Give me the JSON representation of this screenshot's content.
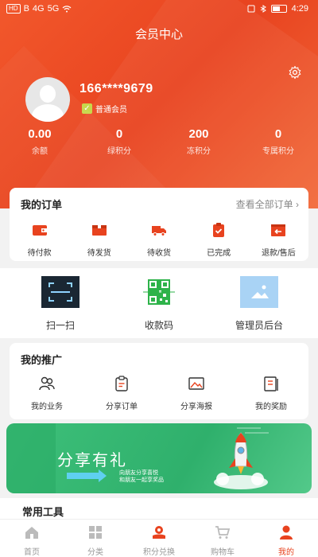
{
  "status_bar": {
    "left": [
      "HD",
      "B",
      "4G",
      "5G"
    ],
    "time": "4:29"
  },
  "header": {
    "title": "会员中心"
  },
  "profile": {
    "phone": "166****9679",
    "level": "普通会员"
  },
  "stats": [
    {
      "value": "0.00",
      "label": "余额"
    },
    {
      "value": "0",
      "label": "绿积分"
    },
    {
      "value": "200",
      "label": "冻积分"
    },
    {
      "value": "0",
      "label": "专属积分"
    }
  ],
  "orders": {
    "title": "我的订单",
    "view_all": "查看全部订单 ›",
    "items": [
      {
        "label": "待付款",
        "icon": "wallet-icon"
      },
      {
        "label": "待发货",
        "icon": "box-icon"
      },
      {
        "label": "待收货",
        "icon": "truck-icon"
      },
      {
        "label": "已完成",
        "icon": "clipboard-check-icon"
      },
      {
        "label": "退款/售后",
        "icon": "refund-icon"
      }
    ]
  },
  "quick_tools": [
    {
      "label": "扫一扫",
      "icon": "scan-icon"
    },
    {
      "label": "收款码",
      "icon": "qrcode-icon"
    },
    {
      "label": "管理员后台",
      "icon": "image-placeholder-icon"
    }
  ],
  "promotion": {
    "title": "我的推广",
    "items": [
      {
        "label": "我的业务",
        "icon": "users-icon"
      },
      {
        "label": "分享订单",
        "icon": "order-icon"
      },
      {
        "label": "分享海报",
        "icon": "poster-icon"
      },
      {
        "label": "我的奖励",
        "icon": "reward-icon"
      }
    ]
  },
  "banner": {
    "headline": "分享有礼",
    "subline_1": "向朋友分享喜悦",
    "subline_2": "和朋友一起享奖品"
  },
  "common_tools": {
    "title": "常用工具"
  },
  "tabbar": [
    {
      "label": "首页",
      "icon": "home-icon"
    },
    {
      "label": "分类",
      "icon": "category-icon"
    },
    {
      "label": "积分兑换",
      "icon": "exchange-icon"
    },
    {
      "label": "购物车",
      "icon": "cart-icon"
    },
    {
      "label": "我的",
      "icon": "user-icon"
    }
  ],
  "colors": {
    "accent": "#e8431f",
    "banner": "#2fb06c"
  }
}
